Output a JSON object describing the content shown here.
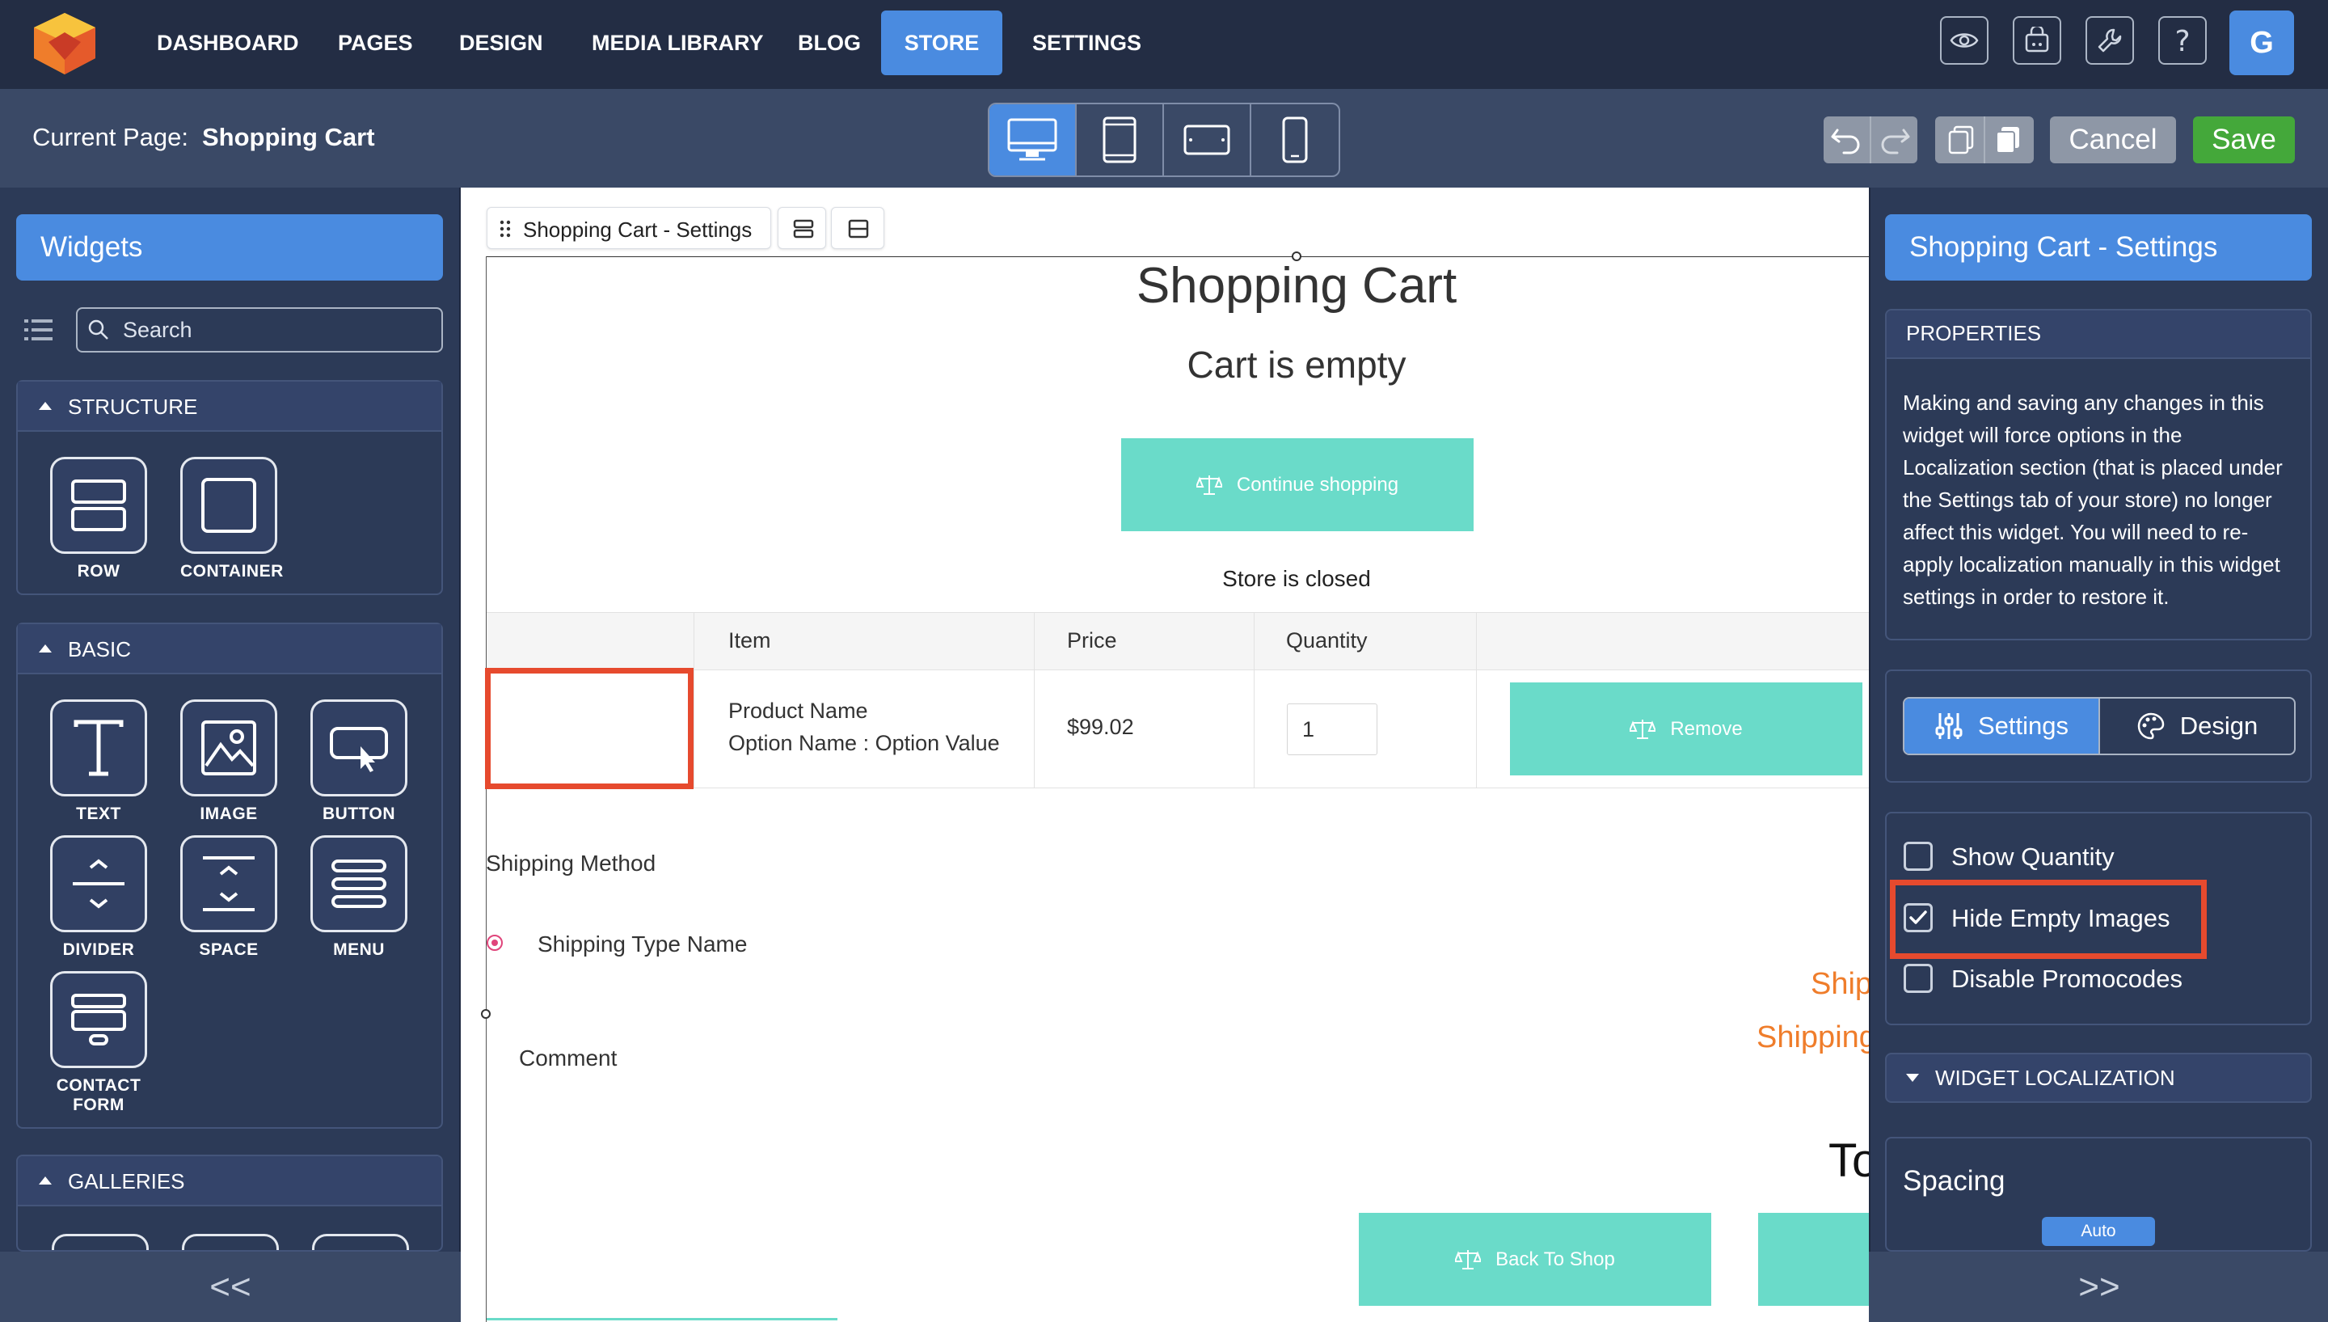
{
  "nav": {
    "items": [
      "DASHBOARD",
      "PAGES",
      "DESIGN",
      "MEDIA LIBRARY",
      "BLOG",
      "STORE",
      "SETTINGS"
    ],
    "active": "STORE",
    "avatar_letter": "G",
    "icons": [
      "eye-icon",
      "store-cart-icon",
      "wrench-icon",
      "help-icon"
    ]
  },
  "subbar": {
    "current_page_label": "Current Page:",
    "current_page_value": "Shopping Cart",
    "devices": [
      "desktop-icon",
      "tablet-icon",
      "tablet-landscape-icon",
      "phone-icon"
    ],
    "active_device": "desktop",
    "cancel_label": "Cancel",
    "save_label": "Save"
  },
  "left_panel": {
    "title": "Widgets",
    "search_placeholder": "Search",
    "sections": [
      {
        "title": "STRUCTURE",
        "items": [
          "ROW",
          "CONTAINER"
        ]
      },
      {
        "title": "BASIC",
        "items": [
          "TEXT",
          "IMAGE",
          "BUTTON",
          "DIVIDER",
          "SPACE",
          "MENU",
          "CONTACT FORM"
        ]
      },
      {
        "title": "GALLERIES",
        "items": []
      }
    ],
    "footer": "<<"
  },
  "canvas": {
    "breadcrumb_label": "Shopping Cart - Settings",
    "title": "Shopping Cart",
    "subtitle": "Cart is empty",
    "continue_label": "Continue shopping",
    "store_closed": "Store is closed",
    "table": {
      "headers": [
        "Item",
        "Price",
        "Quantity"
      ],
      "row": {
        "product_name": "Product Name",
        "option": "Option Name : Option Value",
        "price": "$99.02",
        "quantity": "1",
        "remove_label": "Remove"
      }
    },
    "shipping_method_label": "Shipping Method",
    "shipping_type": "Shipping Type Name",
    "comment_label": "Comment",
    "orange_line1": "Ship",
    "orange_line2": "Shipping",
    "total_partial": "To",
    "back_label": "Back To Shop",
    "accent_teal": "#6adbc9",
    "accent_orange": "#ef7d2b"
  },
  "right_panel": {
    "title": "Shopping Cart - Settings",
    "properties_title": "PROPERTIES",
    "properties_text": "Making and saving any changes in this widget will force options in the Localization section (that is placed under the Settings tab of your store) no longer affect this widget. You will need to re-apply localization manually in this widget settings in order to restore it.",
    "tabs": [
      "Settings",
      "Design"
    ],
    "active_tab": "Settings",
    "checkboxes": [
      {
        "label": "Show Quantity",
        "checked": false
      },
      {
        "label": "Hide Empty Images",
        "checked": true
      },
      {
        "label": "Disable Promocodes",
        "checked": false
      }
    ],
    "localization_title": "WIDGET LOCALIZATION",
    "spacing_title": "Spacing",
    "spacing_badge": "Auto",
    "footer": ">>"
  },
  "colors": {
    "nav_bg": "#232d44",
    "panel_bg": "#2c3a57",
    "accent_blue": "#4a8be0",
    "save_green": "#44a83a",
    "highlight_red": "#e64a2e"
  }
}
